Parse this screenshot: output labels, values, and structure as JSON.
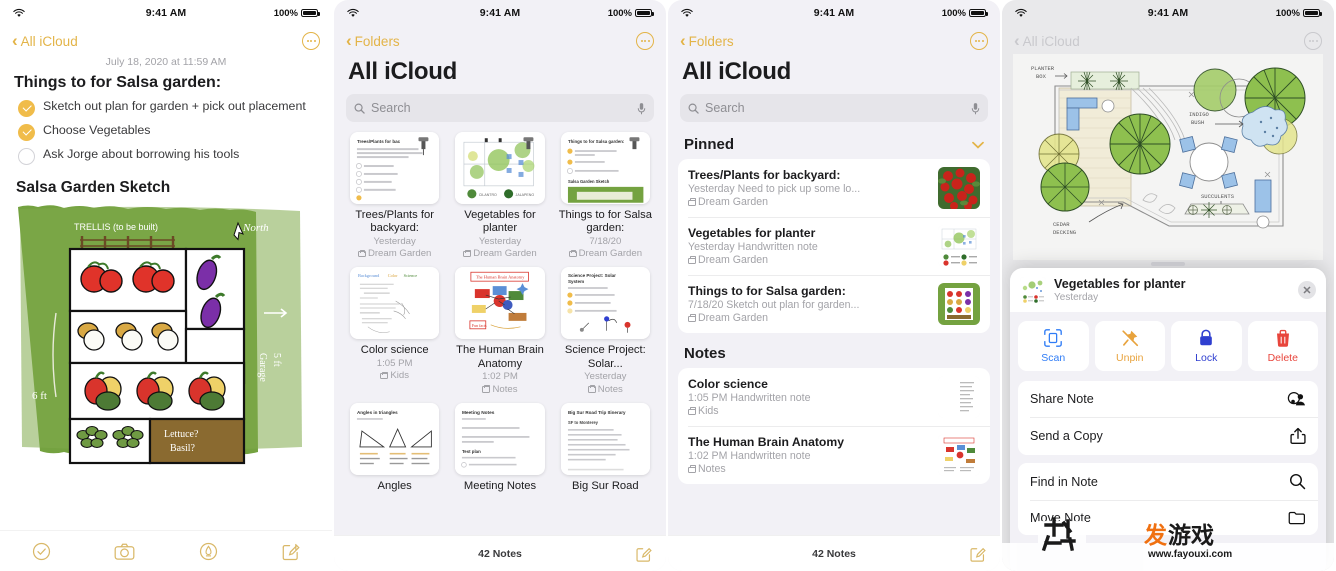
{
  "status_bar": {
    "time": "9:41 AM",
    "battery_percent": "100%",
    "wifi_icon": "wifi-icon"
  },
  "panel1": {
    "nav": {
      "back_label": "All iCloud",
      "more_icon": "ellipsis-circle-icon"
    },
    "note": {
      "date": "July 18, 2020 at 11:59 AM",
      "heading": "Things to for Salsa garden:",
      "checklist": [
        {
          "label": "Sketch out plan for garden + pick out placement",
          "checked": true
        },
        {
          "label": "Choose Vegetables",
          "checked": true
        },
        {
          "label": "Ask Jorge about borrowing his tools",
          "checked": false
        }
      ],
      "subheading": "Salsa Garden Sketch",
      "sketch": {
        "trellis_label": "TRELLIS (to be built)",
        "north_label": "North",
        "width_label": "6 ft",
        "side_label_1": "5 ft",
        "side_label_2": "Garage",
        "bed_labels": [
          "Lettuce?",
          "Basil?"
        ]
      }
    },
    "toolbar": [
      {
        "name": "checklist-icon",
        "label": "Checklist"
      },
      {
        "name": "camera-icon",
        "label": "Camera"
      },
      {
        "name": "markup-pen-icon",
        "label": "Markup"
      },
      {
        "name": "compose-icon",
        "label": "Compose"
      }
    ]
  },
  "panel2": {
    "nav": {
      "back_label": "Folders",
      "more_icon": "ellipsis-circle-icon"
    },
    "title": "All iCloud",
    "search": {
      "placeholder": "Search",
      "mic_icon": "microphone-icon",
      "search_icon": "search-icon"
    },
    "grid": [
      {
        "title": "Trees/Plants for backyard:",
        "sub": "Yesterday",
        "folder": "Dream Garden",
        "thumb": "checklist-doc",
        "pinned": true
      },
      {
        "title": "Vegetables for planter",
        "sub": "Yesterday",
        "folder": "Dream Garden",
        "thumb": "garden-plan",
        "pinned": true
      },
      {
        "title": "Things to for Salsa garden:",
        "sub": "7/18/20",
        "folder": "Dream Garden",
        "thumb": "salsa-garden",
        "pinned": true
      },
      {
        "title": "Color science",
        "sub": "1:05 PM",
        "folder": "Kids",
        "thumb": "handwritten-notes",
        "pinned": false
      },
      {
        "title": "The Human Brain Anatomy",
        "sub": "1:02 PM",
        "folder": "Notes",
        "thumb": "brain-diagram",
        "pinned": false
      },
      {
        "title": "Science Project: Solar...",
        "sub": "Yesterday",
        "folder": "Notes",
        "thumb": "solar-system",
        "pinned": false
      },
      {
        "title": "Angles",
        "sub": "",
        "folder": "",
        "thumb": "angles-triangles",
        "pinned": false
      },
      {
        "title": "Meeting Notes",
        "sub": "",
        "folder": "",
        "thumb": "meeting-notes",
        "pinned": false
      },
      {
        "title": "Big Sur Road",
        "sub": "",
        "folder": "",
        "thumb": "road-trip",
        "pinned": false
      }
    ],
    "bottom": {
      "count": "42 Notes",
      "compose_icon": "compose-icon"
    }
  },
  "panel3": {
    "nav": {
      "back_label": "Folders",
      "more_icon": "ellipsis-circle-icon"
    },
    "title": "All iCloud",
    "search": {
      "placeholder": "Search",
      "mic_icon": "microphone-icon",
      "search_icon": "search-icon"
    },
    "sections": [
      {
        "heading": "Pinned",
        "collapse_icon": "chevron-down-icon",
        "rows": [
          {
            "title": "Trees/Plants for backyard:",
            "meta": "Yesterday  Need to pick up some lo...",
            "folder": "Dream Garden",
            "thumb": "red-flowers"
          },
          {
            "title": "Vegetables for planter",
            "meta": "Yesterday  Handwritten note",
            "folder": "Dream Garden",
            "thumb": "garden-plan"
          },
          {
            "title": "Things to for Salsa garden:",
            "meta": "7/18/20  Sketch out plan for garden...",
            "folder": "Dream Garden",
            "thumb": "salsa-garden"
          }
        ]
      },
      {
        "heading": "Notes",
        "collapse_icon": "",
        "rows": [
          {
            "title": "Color science",
            "meta": "1:05 PM  Handwritten note",
            "folder": "Kids",
            "thumb": "handwritten-notes"
          },
          {
            "title": "The Human Brain Anatomy",
            "meta": "1:02 PM  Handwritten note",
            "folder": "Notes",
            "thumb": "brain-diagram"
          }
        ]
      }
    ],
    "bottom": {
      "count": "42 Notes",
      "compose_icon": "compose-icon"
    }
  },
  "panel4": {
    "nav": {
      "back_label": "All iCloud",
      "more_icon": "ellipsis-circle-icon"
    },
    "background_sketch": {
      "labels": [
        "PLANTER BOX",
        "INDIGO BUSH",
        "SUCCULENTS",
        "CEDAR DECKING"
      ]
    },
    "sheet": {
      "note_title": "Vegetables for planter",
      "note_sub": "Yesterday",
      "close_icon": "close-icon",
      "quick_actions": [
        {
          "label": "Scan",
          "icon": "scan-document-icon",
          "color": "#2f7cf6"
        },
        {
          "label": "Unpin",
          "icon": "unpin-icon",
          "color": "#e8a33d"
        },
        {
          "label": "Lock",
          "icon": "lock-icon",
          "color": "#2f3fd0"
        },
        {
          "label": "Delete",
          "icon": "trash-icon",
          "color": "#e8453c"
        }
      ],
      "actions": [
        {
          "label": "Share Note",
          "icon": "share-person-icon"
        },
        {
          "label": "Send a Copy",
          "icon": "share-up-arrow-icon"
        },
        {
          "label": "Find in Note",
          "icon": "magnifier-icon"
        },
        {
          "label": "Move Note",
          "icon": "folder-icon"
        }
      ]
    }
  },
  "watermark": {
    "text": "www.fayouxi.com",
    "logo": "fayouxi-logo"
  },
  "colors": {
    "accent": "#e3b448",
    "check": "#f0bc4a",
    "background": "#f2f1f6",
    "blue": "#2f7cf6",
    "red": "#e8453c"
  }
}
